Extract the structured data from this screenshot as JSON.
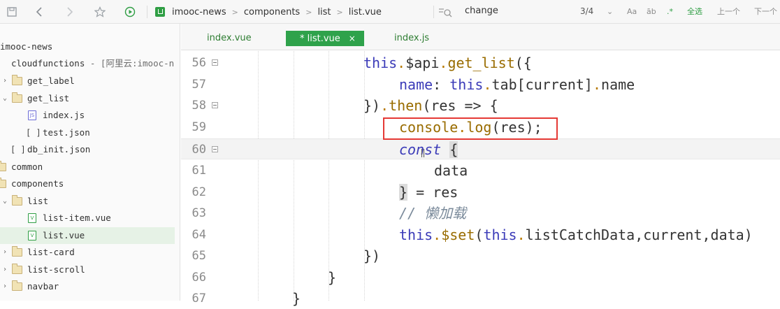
{
  "toolbar": {
    "icons": [
      "save-icon",
      "back-arrow-icon",
      "forward-arrow-icon",
      "star-icon",
      "run-icon"
    ],
    "breadcrumb": [
      "imooc-news",
      "components",
      "list",
      "list.vue"
    ],
    "find": {
      "text": "change",
      "count": "3/4",
      "btn_aa": "Aa",
      "btn_ab": "āb",
      "btn_regex": ".*",
      "btn_select_all": "全选",
      "btn_prev": "上一个",
      "btn_next": "下一个"
    }
  },
  "sidebar": {
    "items": [
      {
        "label": "imooc-news"
      },
      {
        "label": "cloudfunctions",
        "suffix": " - [阿里云:imooc-n"
      },
      {
        "label": "get_label"
      },
      {
        "label": "get_list"
      },
      {
        "label": "index.js"
      },
      {
        "label": "test.json"
      },
      {
        "label": "db_init.json"
      },
      {
        "label": "common"
      },
      {
        "label": "components"
      },
      {
        "label": "list"
      },
      {
        "label": "list-item.vue"
      },
      {
        "label": "list.vue"
      },
      {
        "label": "list-card"
      },
      {
        "label": "list-scroll"
      },
      {
        "label": "navbar"
      }
    ],
    "json_icon": "[ ]"
  },
  "tabs": [
    {
      "label": "index.vue"
    },
    {
      "label": "* list.vue",
      "close": "×"
    },
    {
      "label": "index.js"
    }
  ],
  "editor": {
    "line_numbers": [
      "56",
      "57",
      "58",
      "59",
      "60",
      "61",
      "62",
      "63",
      "64",
      "65",
      "66",
      "67"
    ],
    "lines": {
      "l56": {
        "a": "this",
        "b": ".",
        "c": "$api",
        "d": ".",
        "e": "get_list",
        "f": "({"
      },
      "l57": {
        "a": "name",
        "b": ": ",
        "c": "this",
        "d": ".",
        "e": "tab[current]",
        "f": ".",
        "g": "name"
      },
      "l58": {
        "a": "})",
        "b": ".",
        "c": "then",
        "d": "(res => {"
      },
      "l59": {
        "a": "console",
        "b": ".",
        "c": "log",
        "d": "(res);"
      },
      "l60": {
        "a": "const",
        "b": " ",
        "c": "{"
      },
      "l61": {
        "a": "data"
      },
      "l62": {
        "a": "}",
        "b": " = res"
      },
      "l63": {
        "a": "// 懒加载"
      },
      "l64": {
        "a": "this",
        "b": ".",
        "c": "$set",
        "d": "(",
        "e": "this",
        "f": ".",
        "g": "listCatchData,current,data)"
      },
      "l65": {
        "a": "})"
      },
      "l66": {
        "a": "}"
      },
      "l67": {
        "a": "}"
      }
    }
  },
  "colors": {
    "accent": "#2fa24b",
    "highlight_box": "#e53935",
    "keyword": "#3b3bb8"
  }
}
